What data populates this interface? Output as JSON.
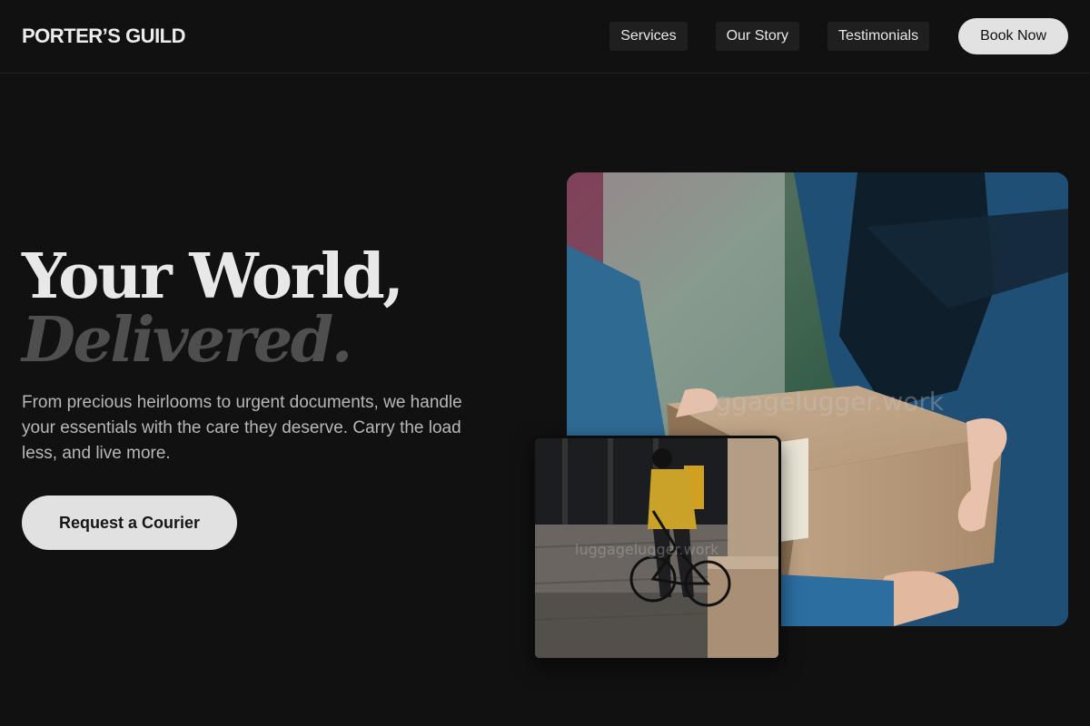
{
  "brand": {
    "name": "PORTER’S GUILD"
  },
  "nav": {
    "links": [
      "Services",
      "Our Story",
      "Testimonials"
    ],
    "cta_label": "Book Now"
  },
  "hero": {
    "headline_line1": "Your World,",
    "headline_line2": "Delivered.",
    "subtext": "From precious heirlooms to urgent documents, we handle your essentials with the care they deserve. Carry the load less, and live more.",
    "cta_label": "Request a Courier"
  },
  "images": {
    "main_watermark": "luggagelugger.work",
    "small_watermark": "luggagelugger.work"
  },
  "colors": {
    "background": "#111111",
    "accent_button": "#e2e2e2",
    "headline_muted": "#4e4e4e"
  }
}
